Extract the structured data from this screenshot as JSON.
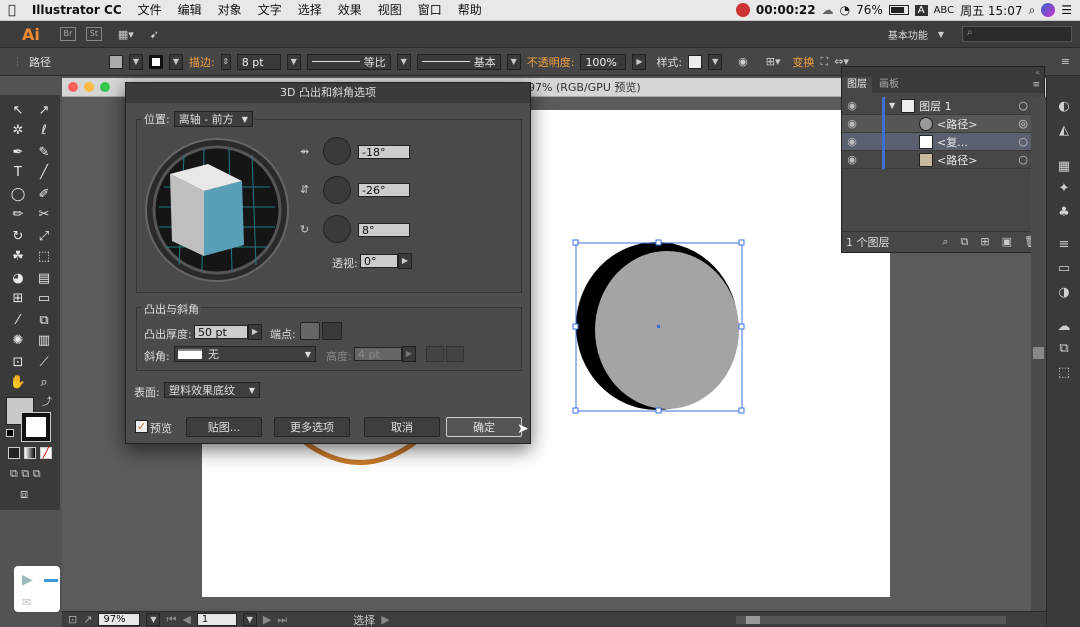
{
  "menubar": {
    "apple": "",
    "app": "Illustrator CC",
    "items": [
      "文件",
      "编辑",
      "对象",
      "文字",
      "选择",
      "效果",
      "视图",
      "窗口",
      "帮助"
    ],
    "timer": "00:00:22",
    "battery": "76%",
    "input_badge": "A",
    "input": "ABC",
    "clock": "周五 15:07"
  },
  "appbar": {
    "logo": "Ai",
    "br": "Br",
    "st": "St",
    "workspace": "基本功能"
  },
  "ctrlbar": {
    "selection": "路径",
    "stroke_label": "描边:",
    "stroke_value": "8 pt",
    "profile_label": "等比",
    "brush_label": "基本",
    "opacity_label": "不透明度:",
    "opacity_value": "100%",
    "style_label": "样式:",
    "transform_label": "变换"
  },
  "doc": {
    "title": "97% (RGB/GPU 预览)",
    "zoom": "97%",
    "page": "1",
    "status": "选择"
  },
  "dialog": {
    "title": "3D 凸出和斜角选项",
    "position_label": "位置:",
    "position_value": "离轴 - 前方",
    "rot_x": "-18°",
    "rot_y": "-26°",
    "rot_z": "8°",
    "perspective_label": "透视:",
    "perspective_value": "0°",
    "extrude_group": "凸出与斜角",
    "depth_label": "凸出厚度:",
    "depth_value": "50 pt",
    "cap_label": "端点:",
    "bevel_label": "斜角:",
    "bevel_value": "无",
    "height_label": "高度:",
    "height_value": "4 pt",
    "surface_label": "表面:",
    "surface_value": "塑料效果底纹",
    "preview_label": "预览",
    "map_btn": "贴图...",
    "more_btn": "更多选项",
    "cancel_btn": "取消",
    "ok_btn": "确定"
  },
  "layers": {
    "tab_layers": "图层",
    "tab_artboards": "画板",
    "rows": [
      {
        "name": "图层 1"
      },
      {
        "name": "<路径>"
      },
      {
        "name": "<复..."
      },
      {
        "name": "<路径>"
      }
    ],
    "count": "1 个图层"
  },
  "colors": {
    "accent_orange": "#f0a040",
    "layer_blue": "#3e6fd6",
    "cube_front": "#5a9fb8",
    "circle_fill": "#a4a4a4"
  }
}
